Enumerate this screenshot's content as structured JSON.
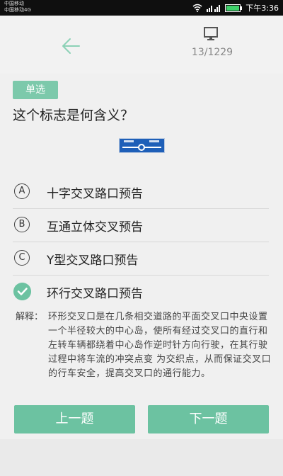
{
  "status_bar": {
    "carrier_1": "中国移动",
    "carrier_2": "中国移动4G",
    "time": "下午3:36"
  },
  "header": {
    "counter": "13/1229",
    "back_icon": "arrow-left-icon",
    "monitor_icon": "monitor-icon"
  },
  "question": {
    "type_tag": "单选",
    "text": "这个标志是何含义？",
    "sign_image_icon": "roundabout-sign-icon"
  },
  "options": [
    {
      "letter": "A",
      "label": "十字交叉路口预告",
      "selected": false
    },
    {
      "letter": "B",
      "label": "互通立体交叉预告",
      "selected": false
    },
    {
      "letter": "C",
      "label": "Y型交叉路口预告",
      "selected": false
    },
    {
      "letter": "",
      "label": "环行交叉路口预告",
      "selected": true
    }
  ],
  "explanation": {
    "label": "解释：",
    "text": "环形交叉口是在几条相交道路的平面交叉口中央设置一个半径较大的中心岛，使所有经过交叉口的直行和左转车辆都绕着中心岛作逆时针方向行驶，在其行驶过程中将车流的冲突点变 为交织点，从而保证交叉口的行车安全，提高交叉口的通行能力。"
  },
  "nav": {
    "prev_label": "上一题",
    "next_label": "下一题"
  },
  "colors": {
    "accent": "#6cc2a1",
    "tag": "#7cc9ab",
    "sign_blue": "#1e5fb8"
  }
}
